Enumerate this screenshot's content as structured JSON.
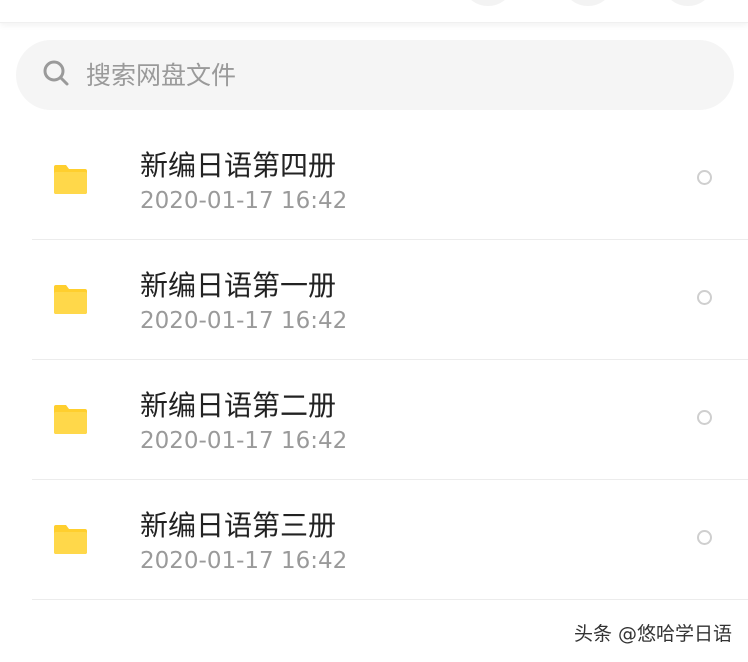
{
  "search": {
    "placeholder": "搜索网盘文件"
  },
  "files": [
    {
      "name": "新编日语第四册",
      "date": "2020-01-17 16:42"
    },
    {
      "name": "新编日语第一册",
      "date": "2020-01-17 16:42"
    },
    {
      "name": "新编日语第二册",
      "date": "2020-01-17 16:42"
    },
    {
      "name": "新编日语第三册",
      "date": "2020-01-17 16:42"
    }
  ],
  "watermark": "头条 @悠哈学日语",
  "colors": {
    "folder": "#FFCF2E",
    "search_bg": "#F5F5F5",
    "secondary_text": "#9A9A9A"
  }
}
